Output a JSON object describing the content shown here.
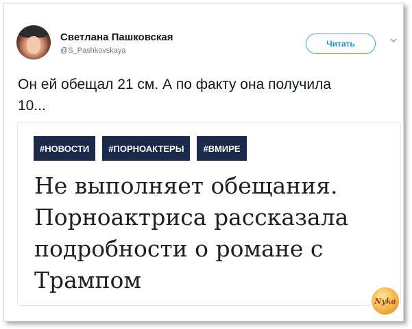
{
  "tweet": {
    "display_name": "Светлана Пашковская",
    "handle": "@S_Pashkovskaya",
    "follow_label": "Читать",
    "text": "Он ей обещал 21 см. А по факту она получила 10...",
    "avatar_icon": "user-avatar",
    "menu_icon": "chevron-down-icon"
  },
  "card": {
    "tags": [
      "#НОВОСТИ",
      "#ПОРНОАКТЕРЫ",
      "#ВМИРЕ"
    ],
    "headline": "Не выполняет обещания. Порноактриса рассказала подробности о романе с Трампом",
    "tag_color": "#1b2a4a"
  },
  "watermark": {
    "text": "Nyka"
  },
  "colors": {
    "accent": "#1b95e0",
    "text": "#14171a",
    "muted": "#657786"
  }
}
